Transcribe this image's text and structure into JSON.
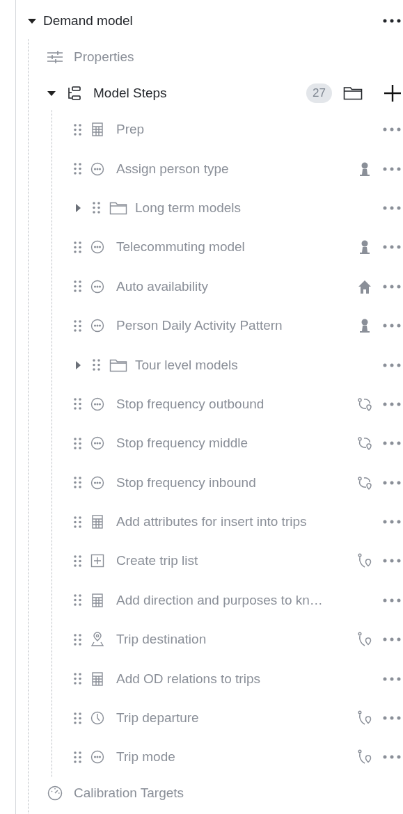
{
  "tree": {
    "label": "Demand model",
    "expanded": true,
    "items": [
      {
        "kind": "properties",
        "label": "Properties"
      },
      {
        "kind": "steps",
        "label": "Model Steps",
        "expanded": true,
        "count": "27",
        "children": [
          {
            "kind": "calculator",
            "label": "Prep"
          },
          {
            "kind": "choice",
            "label": "Assign person type",
            "tag": {
              "kind": "person"
            }
          },
          {
            "kind": "group",
            "label": "Long term models",
            "expanded": false
          },
          {
            "kind": "choice",
            "label": "Telecommuting model",
            "tag": {
              "kind": "person"
            }
          },
          {
            "kind": "choice",
            "label": "Auto availability",
            "tag": {
              "kind": "house"
            }
          },
          {
            "kind": "choice",
            "label": "Person Daily Activity Pattern",
            "tag": {
              "kind": "person"
            }
          },
          {
            "kind": "group",
            "label": "Tour level models",
            "expanded": false
          },
          {
            "kind": "choice",
            "label": "Stop frequency outbound",
            "tag": {
              "kind": "tour"
            }
          },
          {
            "kind": "choice",
            "label": "Stop frequency middle",
            "tag": {
              "kind": "tour"
            }
          },
          {
            "kind": "choice",
            "label": "Stop frequency inbound",
            "tag": {
              "kind": "tour"
            }
          },
          {
            "kind": "calculator",
            "label": "Add attributes for insert into trips"
          },
          {
            "kind": "create",
            "label": "Create trip list",
            "tag": {
              "kind": "trip"
            }
          },
          {
            "kind": "calculator",
            "label": "Add direction and purposes to kn…"
          },
          {
            "kind": "destination",
            "label": "Trip destination",
            "tag": {
              "kind": "trip"
            }
          },
          {
            "kind": "calculator",
            "label": "Add OD relations to trips"
          },
          {
            "kind": "time",
            "label": "Trip departure",
            "tag": {
              "kind": "trip"
            }
          },
          {
            "kind": "choice",
            "label": "Trip mode",
            "tag": {
              "kind": "trip"
            }
          }
        ]
      },
      {
        "kind": "calibration",
        "label": "Calibration Targets"
      }
    ]
  }
}
